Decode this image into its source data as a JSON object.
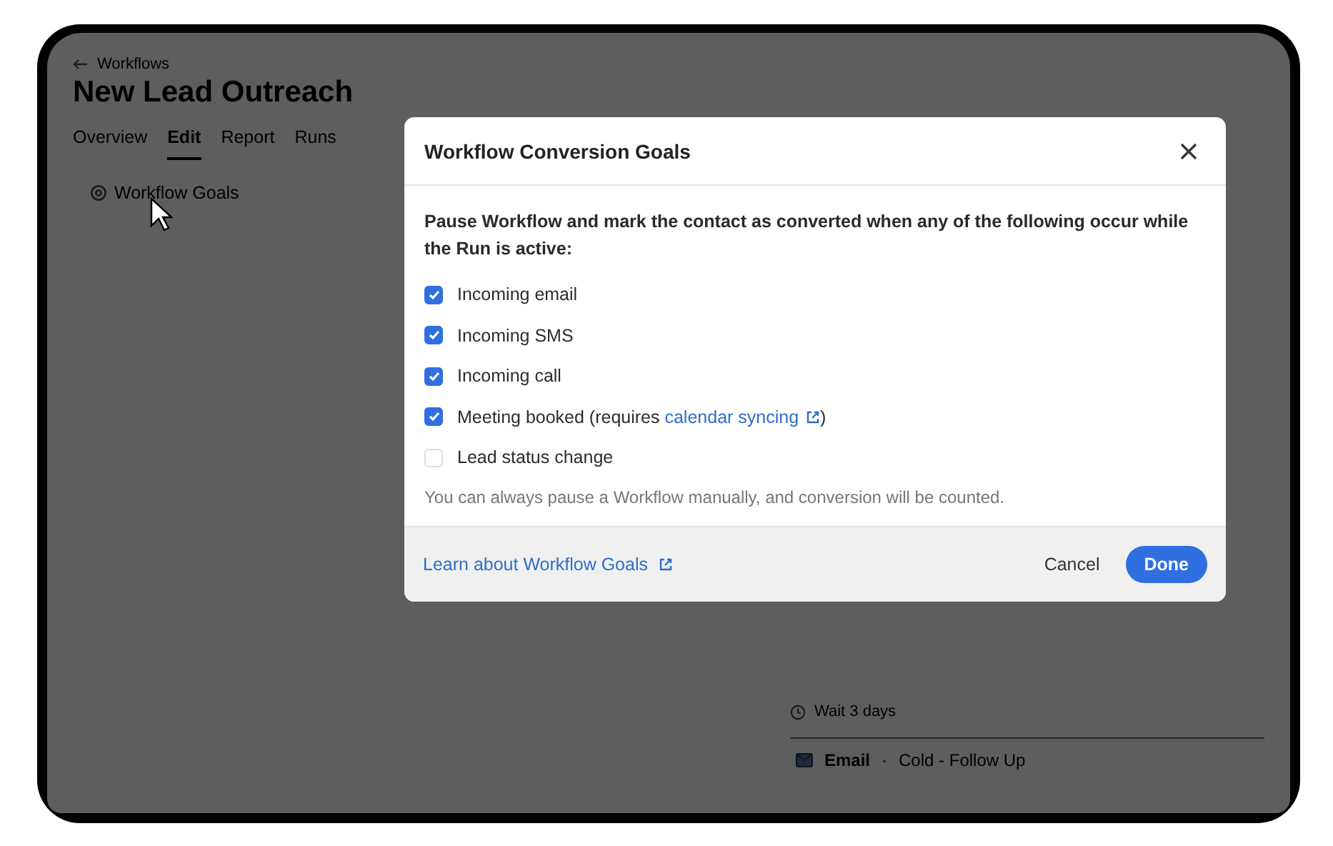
{
  "app": {
    "back_link": "Workflows",
    "title": "New Lead Outreach",
    "tabs": [
      {
        "label": "Overview",
        "selected": false
      },
      {
        "label": "Edit",
        "selected": true
      },
      {
        "label": "Report",
        "selected": false
      },
      {
        "label": "Runs",
        "selected": false
      }
    ],
    "goals_button": "Workflow Goals",
    "wait_step": "Wait 3 days",
    "email_step": {
      "type": "Email",
      "separator": "·",
      "name": "Cold - Follow Up"
    }
  },
  "dialog": {
    "title": "Workflow Conversion Goals",
    "intro": "Pause Workflow and mark the contact as converted when any of the following occur while the Run is active:",
    "options": [
      {
        "label": "Incoming email",
        "checked": true
      },
      {
        "label": "Incoming SMS",
        "checked": true
      },
      {
        "label": "Incoming call",
        "checked": true
      },
      {
        "label": "Meeting booked (requires ",
        "link": "calendar syncing",
        "suffix": ")",
        "checked": true
      },
      {
        "label": "Lead status change",
        "checked": false
      }
    ],
    "note": "You can always pause a Workflow manually, and conversion will be counted.",
    "footer_link": "Learn about Workflow Goals",
    "buttons": [
      {
        "label": "Cancel",
        "kind": "secondary"
      },
      {
        "label": "Done",
        "kind": "primary"
      }
    ]
  }
}
